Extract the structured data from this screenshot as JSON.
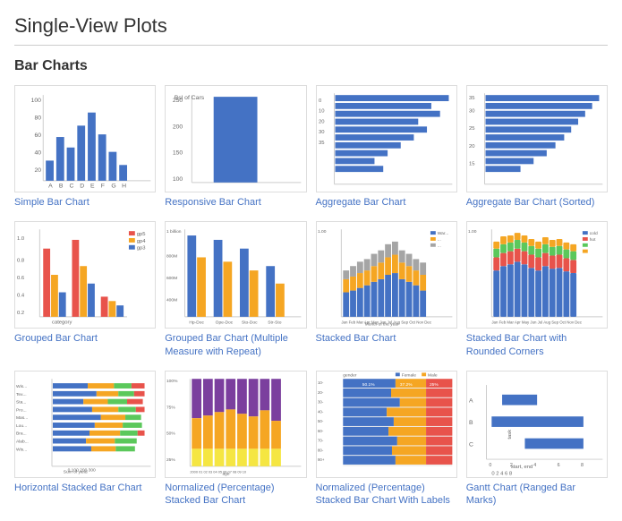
{
  "page": {
    "title": "Single-View Plots",
    "section": "Bar Charts"
  },
  "charts": [
    {
      "id": "chart1",
      "label": "Simple Bar Chart"
    },
    {
      "id": "chart2",
      "label": "Responsive Bar Chart"
    },
    {
      "id": "chart3",
      "label": "Aggregate Bar Chart"
    },
    {
      "id": "chart4",
      "label": "Aggregate Bar Chart (Sorted)"
    },
    {
      "id": "chart5",
      "label": "Grouped Bar Chart"
    },
    {
      "id": "chart6",
      "label": "Grouped Bar Chart (Multiple Measure with Repeat)"
    },
    {
      "id": "chart7",
      "label": "Stacked Bar Chart"
    },
    {
      "id": "chart8",
      "label": "Stacked Bar Chart with Rounded Corners"
    },
    {
      "id": "chart9",
      "label": "Horizontal Stacked Bar Chart"
    },
    {
      "id": "chart10",
      "label": "Normalized (Percentage) Stacked Bar Chart"
    },
    {
      "id": "chart11",
      "label": "Normalized (Percentage) Stacked Bar Chart With Labels"
    },
    {
      "id": "chart12",
      "label": "Gantt Chart (Ranged Bar Marks)"
    }
  ]
}
